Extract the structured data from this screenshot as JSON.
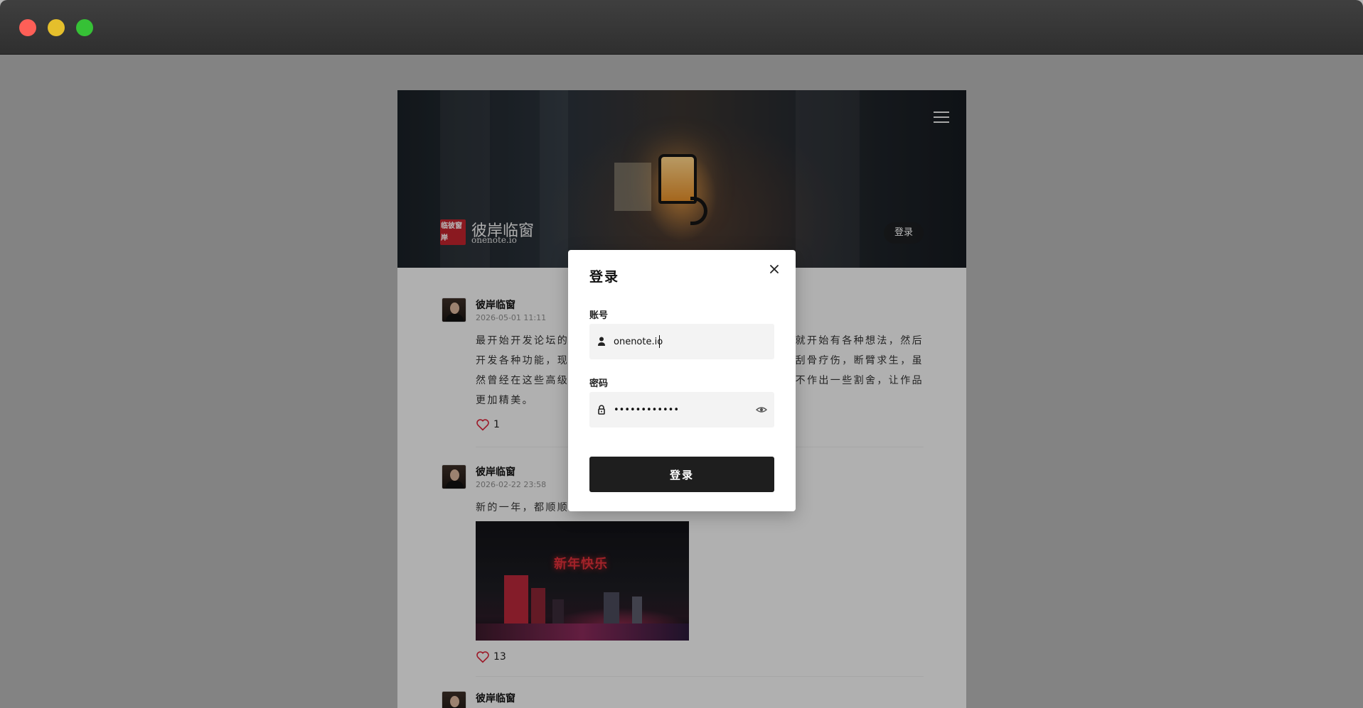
{
  "window": {
    "controls": [
      "close",
      "minimize",
      "maximize"
    ]
  },
  "header": {
    "brand_seal": "临彼窗岸",
    "brand_name": "彼岸临窗",
    "brand_sub": "onenote.io",
    "login_label": "登录",
    "menu_icon": "menu-icon"
  },
  "posts": [
    {
      "author": "彼岸临窗",
      "time": "2026-05-01 11:11",
      "text_visible": "最开始开发论坛的",
      "text_lines": [
        "最开始开发论坛的",
        "开发各种功能，现",
        "然曾经在这些高级",
        "更加精美。"
      ],
      "text_right": [
        "就开始有各种想法，然后",
        "刮骨疗伤，断臂求生，虽",
        "不作出一些割舍，让作品",
        ""
      ],
      "likes": "1"
    },
    {
      "author": "彼岸临窗",
      "time": "2026-02-22 23:58",
      "text_line": "新的一年，都顺顺",
      "image_text": "新年快乐",
      "likes": "13"
    },
    {
      "author": "彼岸临窗"
    }
  ],
  "login_modal": {
    "title": "登录",
    "account_label": "账号",
    "account_value": "onenote.io",
    "password_label": "密码",
    "password_value": "••••••••••••",
    "submit_label": "登录"
  },
  "colors": {
    "accent": "#1e1e1e",
    "like": "#d9253a",
    "seal": "#c0232d"
  }
}
